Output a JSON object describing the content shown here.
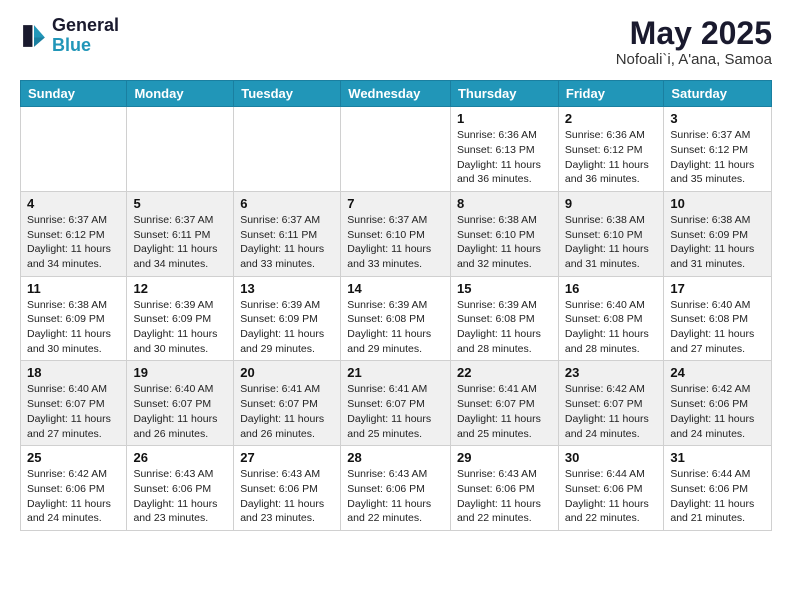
{
  "header": {
    "logo_general": "General",
    "logo_blue": "Blue",
    "month_year": "May 2025",
    "location": "Nofoali`i, A'ana, Samoa"
  },
  "days_of_week": [
    "Sunday",
    "Monday",
    "Tuesday",
    "Wednesday",
    "Thursday",
    "Friday",
    "Saturday"
  ],
  "weeks": [
    [
      {
        "day": "",
        "info": ""
      },
      {
        "day": "",
        "info": ""
      },
      {
        "day": "",
        "info": ""
      },
      {
        "day": "",
        "info": ""
      },
      {
        "day": "1",
        "info": "Sunrise: 6:36 AM\nSunset: 6:13 PM\nDaylight: 11 hours\nand 36 minutes."
      },
      {
        "day": "2",
        "info": "Sunrise: 6:36 AM\nSunset: 6:12 PM\nDaylight: 11 hours\nand 36 minutes."
      },
      {
        "day": "3",
        "info": "Sunrise: 6:37 AM\nSunset: 6:12 PM\nDaylight: 11 hours\nand 35 minutes."
      }
    ],
    [
      {
        "day": "4",
        "info": "Sunrise: 6:37 AM\nSunset: 6:12 PM\nDaylight: 11 hours\nand 34 minutes."
      },
      {
        "day": "5",
        "info": "Sunrise: 6:37 AM\nSunset: 6:11 PM\nDaylight: 11 hours\nand 34 minutes."
      },
      {
        "day": "6",
        "info": "Sunrise: 6:37 AM\nSunset: 6:11 PM\nDaylight: 11 hours\nand 33 minutes."
      },
      {
        "day": "7",
        "info": "Sunrise: 6:37 AM\nSunset: 6:10 PM\nDaylight: 11 hours\nand 33 minutes."
      },
      {
        "day": "8",
        "info": "Sunrise: 6:38 AM\nSunset: 6:10 PM\nDaylight: 11 hours\nand 32 minutes."
      },
      {
        "day": "9",
        "info": "Sunrise: 6:38 AM\nSunset: 6:10 PM\nDaylight: 11 hours\nand 31 minutes."
      },
      {
        "day": "10",
        "info": "Sunrise: 6:38 AM\nSunset: 6:09 PM\nDaylight: 11 hours\nand 31 minutes."
      }
    ],
    [
      {
        "day": "11",
        "info": "Sunrise: 6:38 AM\nSunset: 6:09 PM\nDaylight: 11 hours\nand 30 minutes."
      },
      {
        "day": "12",
        "info": "Sunrise: 6:39 AM\nSunset: 6:09 PM\nDaylight: 11 hours\nand 30 minutes."
      },
      {
        "day": "13",
        "info": "Sunrise: 6:39 AM\nSunset: 6:09 PM\nDaylight: 11 hours\nand 29 minutes."
      },
      {
        "day": "14",
        "info": "Sunrise: 6:39 AM\nSunset: 6:08 PM\nDaylight: 11 hours\nand 29 minutes."
      },
      {
        "day": "15",
        "info": "Sunrise: 6:39 AM\nSunset: 6:08 PM\nDaylight: 11 hours\nand 28 minutes."
      },
      {
        "day": "16",
        "info": "Sunrise: 6:40 AM\nSunset: 6:08 PM\nDaylight: 11 hours\nand 28 minutes."
      },
      {
        "day": "17",
        "info": "Sunrise: 6:40 AM\nSunset: 6:08 PM\nDaylight: 11 hours\nand 27 minutes."
      }
    ],
    [
      {
        "day": "18",
        "info": "Sunrise: 6:40 AM\nSunset: 6:07 PM\nDaylight: 11 hours\nand 27 minutes."
      },
      {
        "day": "19",
        "info": "Sunrise: 6:40 AM\nSunset: 6:07 PM\nDaylight: 11 hours\nand 26 minutes."
      },
      {
        "day": "20",
        "info": "Sunrise: 6:41 AM\nSunset: 6:07 PM\nDaylight: 11 hours\nand 26 minutes."
      },
      {
        "day": "21",
        "info": "Sunrise: 6:41 AM\nSunset: 6:07 PM\nDaylight: 11 hours\nand 25 minutes."
      },
      {
        "day": "22",
        "info": "Sunrise: 6:41 AM\nSunset: 6:07 PM\nDaylight: 11 hours\nand 25 minutes."
      },
      {
        "day": "23",
        "info": "Sunrise: 6:42 AM\nSunset: 6:07 PM\nDaylight: 11 hours\nand 24 minutes."
      },
      {
        "day": "24",
        "info": "Sunrise: 6:42 AM\nSunset: 6:06 PM\nDaylight: 11 hours\nand 24 minutes."
      }
    ],
    [
      {
        "day": "25",
        "info": "Sunrise: 6:42 AM\nSunset: 6:06 PM\nDaylight: 11 hours\nand 24 minutes."
      },
      {
        "day": "26",
        "info": "Sunrise: 6:43 AM\nSunset: 6:06 PM\nDaylight: 11 hours\nand 23 minutes."
      },
      {
        "day": "27",
        "info": "Sunrise: 6:43 AM\nSunset: 6:06 PM\nDaylight: 11 hours\nand 23 minutes."
      },
      {
        "day": "28",
        "info": "Sunrise: 6:43 AM\nSunset: 6:06 PM\nDaylight: 11 hours\nand 22 minutes."
      },
      {
        "day": "29",
        "info": "Sunrise: 6:43 AM\nSunset: 6:06 PM\nDaylight: 11 hours\nand 22 minutes."
      },
      {
        "day": "30",
        "info": "Sunrise: 6:44 AM\nSunset: 6:06 PM\nDaylight: 11 hours\nand 22 minutes."
      },
      {
        "day": "31",
        "info": "Sunrise: 6:44 AM\nSunset: 6:06 PM\nDaylight: 11 hours\nand 21 minutes."
      }
    ]
  ]
}
